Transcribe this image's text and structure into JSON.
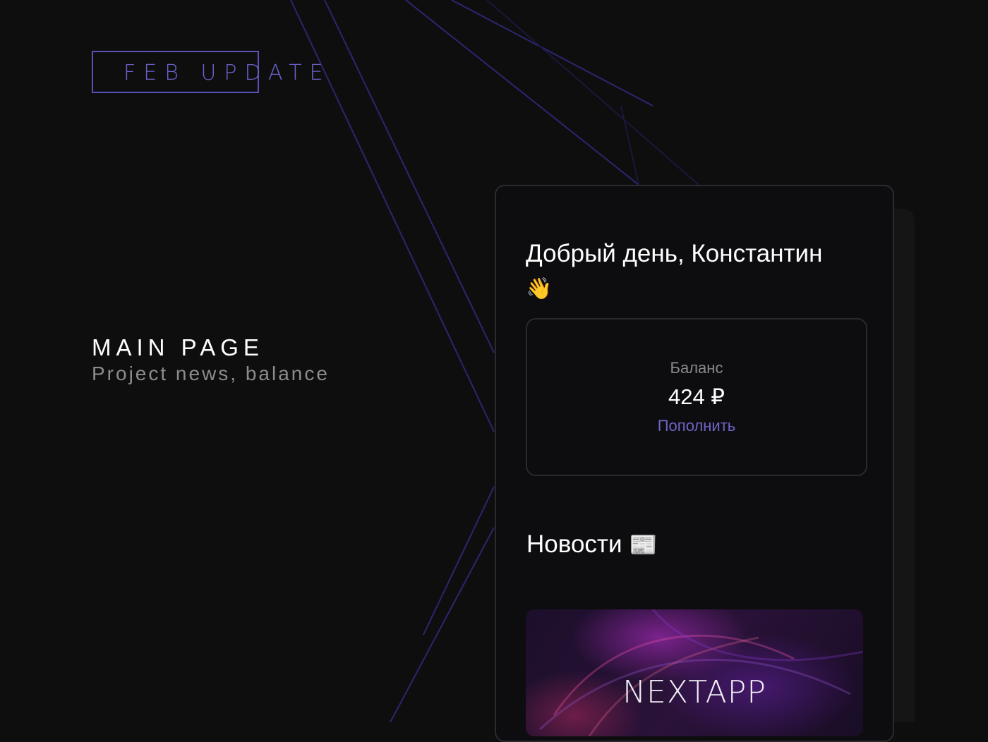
{
  "badge": {
    "text": "FEB UPDATE"
  },
  "section": {
    "title": "MAIN PAGE",
    "subtitle": "Project news, balance"
  },
  "greeting": {
    "text": "Добрый день, Константин",
    "emoji": "👋"
  },
  "balance": {
    "label": "Баланс",
    "value": "424 ₽",
    "action": "Пополнить"
  },
  "news": {
    "title": "Новости",
    "emoji": "📰",
    "cards": [
      {
        "brand": "NEXTAPP"
      }
    ]
  },
  "colors": {
    "accent": "#6c64c6",
    "background": "#0e0e0f",
    "panel": "#0d0d10"
  }
}
